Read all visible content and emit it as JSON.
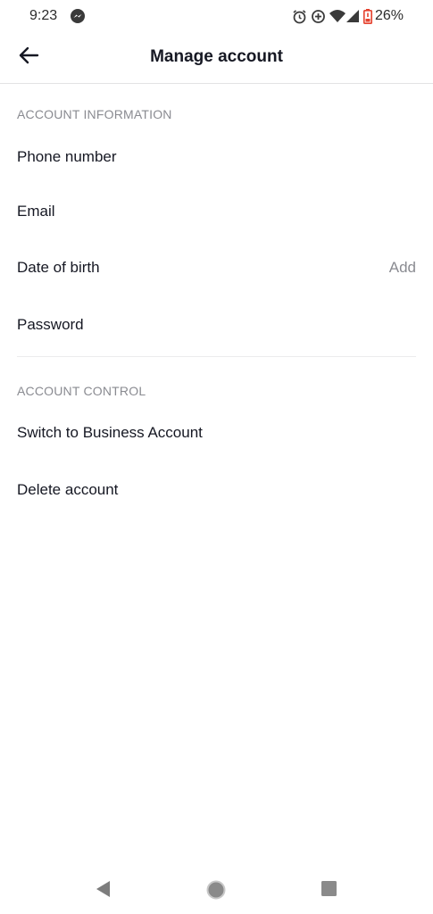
{
  "status_bar": {
    "time": "9:23",
    "battery": "26%",
    "icons": [
      "messenger-icon",
      "alarm-icon",
      "data-saver-icon",
      "wifi-icon",
      "signal-icon",
      "battery-icon"
    ],
    "battery_color": "#e5412d"
  },
  "header": {
    "title": "Manage account",
    "back_icon": "arrow-left-icon"
  },
  "sections": [
    {
      "title": "ACCOUNT INFORMATION",
      "items": [
        {
          "label": "Phone number",
          "value": ""
        },
        {
          "label": "Email",
          "value": ""
        },
        {
          "label": "Date of birth",
          "value": "Add"
        },
        {
          "label": "Password",
          "value": ""
        }
      ]
    },
    {
      "title": "ACCOUNT CONTROL",
      "items": [
        {
          "label": "Switch to Business Account"
        },
        {
          "label": "Delete account"
        }
      ]
    }
  ],
  "nav_bar": {
    "icons": [
      "back-triangle-icon",
      "home-circle-icon",
      "recents-square-icon"
    ]
  }
}
